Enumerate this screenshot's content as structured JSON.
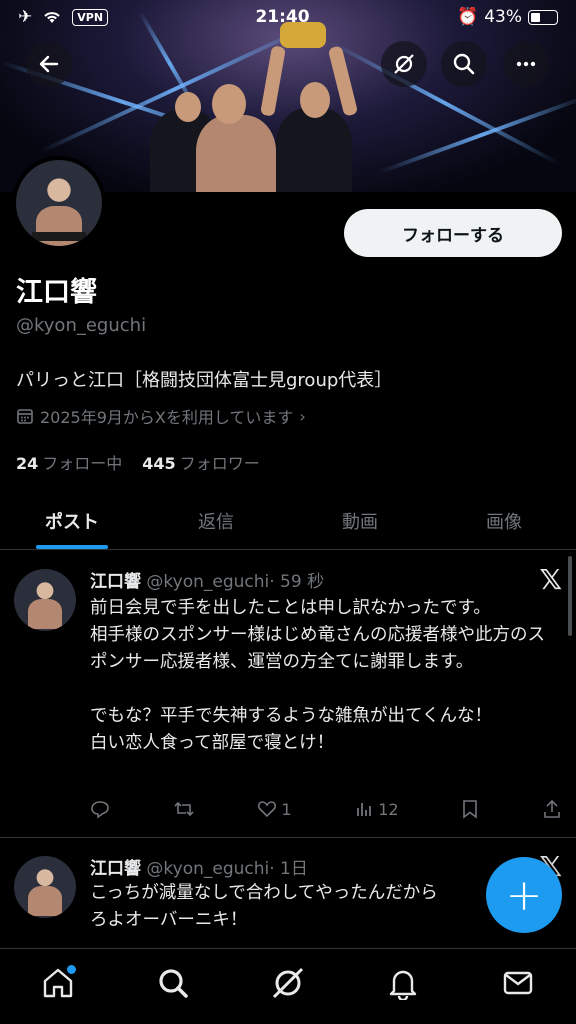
{
  "status_bar": {
    "time": "21:40",
    "vpn": "VPN",
    "battery": "43%"
  },
  "profile": {
    "follow_label": "フォローする",
    "name": "江口響",
    "handle": "@kyon_eguchi",
    "bio": "パリっと江口［格闘技団体富士見group代表］",
    "joined": "2025年9月からXを利用しています",
    "following_count": "24",
    "following_label": "フォロー中",
    "followers_count": "445",
    "followers_label": "フォロワー"
  },
  "tabs": [
    {
      "label": "ポスト",
      "active": true
    },
    {
      "label": "返信"
    },
    {
      "label": "動画"
    },
    {
      "label": "画像"
    }
  ],
  "posts": [
    {
      "name": "江口響",
      "handle": "@kyon_eguchi",
      "time": "· 59 秒",
      "body": "前日会見で手を出したことは申し訳なかったです。\n相手様のスポンサー様はじめ竜さんの応援者様や此方のスポンサー応援者様、運営の方全てに謝罪します。\n\nでもな？平手で失神するような雑魚が出てくんな！\n白い恋人食って部屋で寝とけ！",
      "likes": "1",
      "views": "12"
    },
    {
      "name": "江口響",
      "handle": "@kyon_eguchi",
      "time": "· 1日",
      "body": "こっちが減量なしで合わしてやったんだから\nろよオーバーニキ！"
    }
  ],
  "fab_label": "+",
  "icons": {
    "back": "back-arrow-icon",
    "grok": "grok-icon",
    "search": "search-icon",
    "more": "more-icon",
    "nav": [
      "home-icon",
      "search-icon",
      "grok-icon",
      "notifications-icon",
      "messages-icon"
    ]
  },
  "colors": {
    "accent": "#1d9bf0",
    "background": "#000000",
    "muted": "#71767b"
  }
}
